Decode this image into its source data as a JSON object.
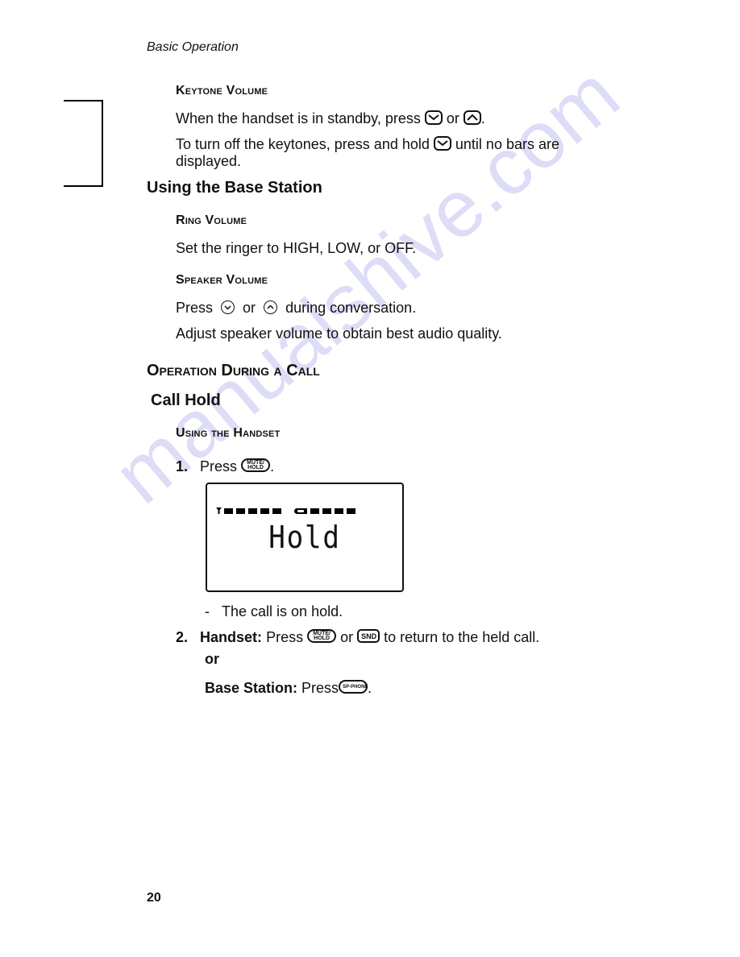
{
  "page": {
    "running_head": "Basic Operation",
    "page_number": "20",
    "watermark": "manualshive.com"
  },
  "keytone_volume": {
    "heading": "Keytone Volume",
    "line1_a": "When the handset is in standby, press",
    "line1_key1": "down-arrow-key",
    "line1_or": "or",
    "line1_key2": "up-arrow-key",
    "line1_end": ".",
    "line2_a": "To turn off the keytones, press and hold",
    "line2_key": "down-arrow-key",
    "line2_b": "until no bars are",
    "line2_c": "displayed."
  },
  "base_station": {
    "heading": "Using the Base Station",
    "ring_volume": {
      "heading": "Ring Volume",
      "text": "Set the ringer to HIGH, LOW, or OFF."
    },
    "speaker_volume": {
      "heading": "Speaker Volume",
      "press": "Press",
      "or": "or",
      "during": "during conversation.",
      "adjust": "Adjust speaker volume to obtain best audio quality."
    }
  },
  "operation_during_call": {
    "heading": "Operation During a Call",
    "call_hold": {
      "heading": "Call Hold",
      "using_handset": "Using the Handset",
      "step1_num": "1.",
      "step1_text": "Press",
      "step1_end": ".",
      "mute_key_top": "MUTE/",
      "mute_key_bottom": "HOLD",
      "lcd": {
        "signal_bars": 5,
        "battery_bars": 4,
        "text": "Hold"
      },
      "bullet": "-",
      "note": "The call is on hold.",
      "step2_num": "2.",
      "step2_label": "Handset:",
      "step2_press": "Press",
      "step2_or": "or",
      "snd_key": "SND",
      "step2_end": "to return to the held call.",
      "or_line": "or",
      "base_label": "Base Station:",
      "base_press": "Press",
      "sp_phone_key": "SP-PHONE",
      "base_end": "."
    }
  }
}
